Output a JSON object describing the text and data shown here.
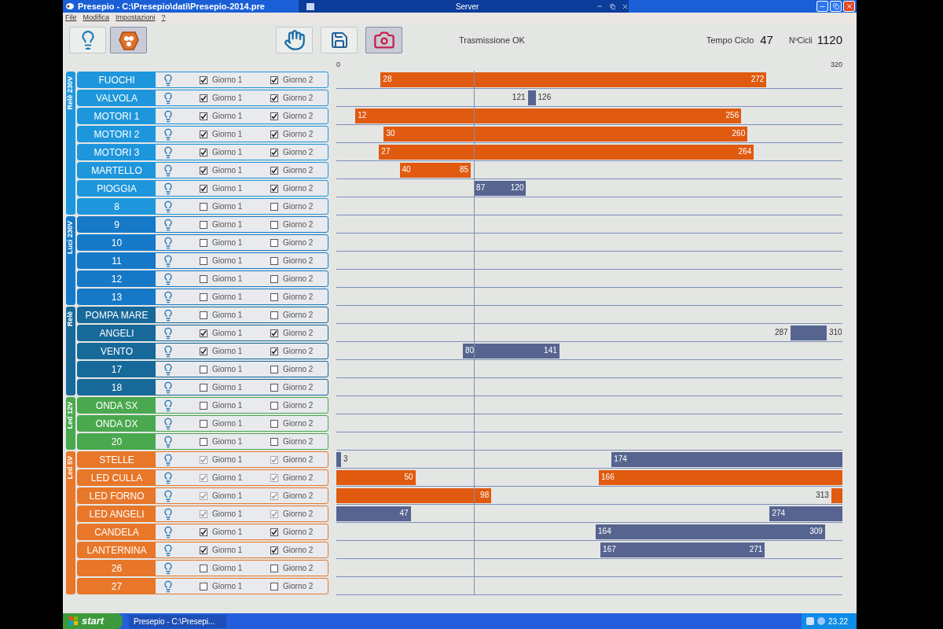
{
  "window": {
    "title": "Presepio - C:\\Presepio\\dati\\Presepio-2014.pre",
    "overlay_title": "Server"
  },
  "menu": [
    "File",
    "Modifica",
    "Impostazioni",
    "?"
  ],
  "toolbar": [
    {
      "kind": "bulb",
      "selected": false
    },
    {
      "kind": "blob",
      "selected": true
    },
    {
      "kind": "hand",
      "selected": false
    },
    {
      "kind": "save",
      "selected": false
    },
    {
      "kind": "camera",
      "selected": true
    }
  ],
  "status": {
    "message": "Trasmissione OK",
    "cycle_time_label": "Tempo Ciclo",
    "cycle_time": "47",
    "cycles_label": "NºCicli",
    "cycles": "1120"
  },
  "axis": {
    "min": "0",
    "max": "320"
  },
  "groups": [
    {
      "label": "Relè 230V",
      "color": "#1e96dc",
      "rows": [
        {
          "name": "FUOCHI",
          "days": [
            {
              "label": "Giorno 1",
              "checked": true,
              "disabled": false
            },
            {
              "label": "Giorno 2",
              "checked": true,
              "disabled": false
            }
          ],
          "segments": [
            {
              "from": "28",
              "to": "272",
              "color": "#e05a10"
            }
          ]
        },
        {
          "name": "VALVOLA",
          "days": [
            {
              "label": "Giorno 1",
              "checked": true,
              "disabled": false
            },
            {
              "label": "Giorno 2",
              "checked": true,
              "disabled": false
            }
          ],
          "segments": [
            {
              "from": "121",
              "to": "126",
              "color": "#56648f"
            }
          ]
        },
        {
          "name": "MOTORI 1",
          "days": [
            {
              "label": "Giorno 1",
              "checked": true,
              "disabled": false
            },
            {
              "label": "Giorno 2",
              "checked": true,
              "disabled": false
            }
          ],
          "segments": [
            {
              "from": "12",
              "to": "256",
              "color": "#e05a10"
            }
          ]
        },
        {
          "name": "MOTORI 2",
          "days": [
            {
              "label": "Giorno 1",
              "checked": true,
              "disabled": false
            },
            {
              "label": "Giorno 2",
              "checked": true,
              "disabled": false
            }
          ],
          "segments": [
            {
              "from": "30",
              "to": "260",
              "color": "#e05a10"
            }
          ]
        },
        {
          "name": "MOTORI 3",
          "days": [
            {
              "label": "Giorno 1",
              "checked": true,
              "disabled": false
            },
            {
              "label": "Giorno 2",
              "checked": true,
              "disabled": false
            }
          ],
          "segments": [
            {
              "from": "27",
              "to": "264",
              "color": "#e05a10"
            }
          ]
        },
        {
          "name": "MARTELLO",
          "days": [
            {
              "label": "Giorno 1",
              "checked": true,
              "disabled": false
            },
            {
              "label": "Giorno 2",
              "checked": true,
              "disabled": false
            }
          ],
          "segments": [
            {
              "from": "40",
              "to": "85",
              "color": "#e05a10"
            }
          ]
        },
        {
          "name": "PIOGGIA",
          "days": [
            {
              "label": "Giorno 1",
              "checked": true,
              "disabled": false
            },
            {
              "label": "Giorno 2",
              "checked": true,
              "disabled": false
            }
          ],
          "segments": [
            {
              "from": "87",
              "to": "120",
              "color": "#56648f"
            }
          ]
        },
        {
          "name": "8",
          "days": [
            {
              "label": "Giorno 1",
              "checked": false,
              "disabled": false
            },
            {
              "label": "Giorno 2",
              "checked": false,
              "disabled": false
            }
          ],
          "segments": []
        }
      ]
    },
    {
      "label": "Luci 230V",
      "color": "#1679c8",
      "rows": [
        {
          "name": "9",
          "days": [
            {
              "label": "Giorno 1",
              "checked": false,
              "disabled": false
            },
            {
              "label": "Giorno 2",
              "checked": false,
              "disabled": false
            }
          ],
          "segments": []
        },
        {
          "name": "10",
          "days": [
            {
              "label": "Giorno 1",
              "checked": false,
              "disabled": false
            },
            {
              "label": "Giorno 2",
              "checked": false,
              "disabled": false
            }
          ],
          "segments": []
        },
        {
          "name": "11",
          "days": [
            {
              "label": "Giorno 1",
              "checked": false,
              "disabled": false
            },
            {
              "label": "Giorno 2",
              "checked": false,
              "disabled": false
            }
          ],
          "segments": []
        },
        {
          "name": "12",
          "days": [
            {
              "label": "Giorno 1",
              "checked": false,
              "disabled": false
            },
            {
              "label": "Giorno 2",
              "checked": false,
              "disabled": false
            }
          ],
          "segments": []
        },
        {
          "name": "13",
          "days": [
            {
              "label": "Giorno 1",
              "checked": false,
              "disabled": false
            },
            {
              "label": "Giorno 2",
              "checked": false,
              "disabled": false
            }
          ],
          "segments": []
        }
      ]
    },
    {
      "label": "Relè",
      "color": "#17699a",
      "rows": [
        {
          "name": "POMPA MARE",
          "days": [
            {
              "label": "Giorno 1",
              "checked": false,
              "disabled": false
            },
            {
              "label": "Giorno 2",
              "checked": false,
              "disabled": false
            }
          ],
          "segments": []
        },
        {
          "name": "ANGELI",
          "days": [
            {
              "label": "Giorno 1",
              "checked": true,
              "disabled": false
            },
            {
              "label": "Giorno 2",
              "checked": true,
              "disabled": false
            }
          ],
          "segments": [
            {
              "from": "287",
              "to": "310",
              "color": "#56648f"
            }
          ]
        },
        {
          "name": "VENTO",
          "days": [
            {
              "label": "Giorno 1",
              "checked": true,
              "disabled": false
            },
            {
              "label": "Giorno 2",
              "checked": true,
              "disabled": false
            }
          ],
          "segments": [
            {
              "from": "80",
              "to": "141",
              "color": "#56648f"
            }
          ]
        },
        {
          "name": "17",
          "days": [
            {
              "label": "Giorno 1",
              "checked": false,
              "disabled": false
            },
            {
              "label": "Giorno 2",
              "checked": false,
              "disabled": false
            }
          ],
          "segments": []
        },
        {
          "name": "18",
          "days": [
            {
              "label": "Giorno 1",
              "checked": false,
              "disabled": false
            },
            {
              "label": "Giorno 2",
              "checked": false,
              "disabled": false
            }
          ],
          "segments": []
        }
      ]
    },
    {
      "label": "Led 12V",
      "color": "#4aa84e",
      "rows": [
        {
          "name": "ONDA SX",
          "days": [
            {
              "label": "Giorno 1",
              "checked": false,
              "disabled": false
            },
            {
              "label": "Giorno 2",
              "checked": false,
              "disabled": false
            }
          ],
          "segments": []
        },
        {
          "name": "ONDA DX",
          "days": [
            {
              "label": "Giorno 1",
              "checked": false,
              "disabled": false
            },
            {
              "label": "Giorno 2",
              "checked": false,
              "disabled": false
            }
          ],
          "segments": []
        },
        {
          "name": "20",
          "days": [
            {
              "label": "Giorno 1",
              "checked": false,
              "disabled": false
            },
            {
              "label": "Giorno 2",
              "checked": false,
              "disabled": false
            }
          ],
          "segments": []
        }
      ]
    },
    {
      "label": "Led 5V",
      "color": "#e8772a",
      "rows": [
        {
          "name": "STELLE",
          "days": [
            {
              "label": "Giorno 1",
              "checked": true,
              "disabled": true
            },
            {
              "label": "Giorno 2",
              "checked": true,
              "disabled": true
            }
          ],
          "segments": [
            {
              "from": "174",
              "to": "3",
              "color": "#56648f"
            }
          ]
        },
        {
          "name": "LED CULLA",
          "days": [
            {
              "label": "Giorno 1",
              "checked": true,
              "disabled": true
            },
            {
              "label": "Giorno 2",
              "checked": true,
              "disabled": true
            }
          ],
          "segments": [
            {
              "from": "166",
              "to": "50",
              "color": "#e05a10"
            }
          ]
        },
        {
          "name": "LED FORNO",
          "days": [
            {
              "label": "Giorno 1",
              "checked": true,
              "disabled": true
            },
            {
              "label": "Giorno 2",
              "checked": true,
              "disabled": true
            }
          ],
          "segments": [
            {
              "from": "313",
              "to": "98",
              "color": "#e05a10"
            }
          ]
        },
        {
          "name": "LED ANGELI",
          "days": [
            {
              "label": "Giorno 1",
              "checked": true,
              "disabled": true
            },
            {
              "label": "Giorno 2",
              "checked": true,
              "disabled": true
            }
          ],
          "segments": [
            {
              "from": "274",
              "to": "47",
              "color": "#56648f"
            }
          ]
        },
        {
          "name": "CANDELA",
          "days": [
            {
              "label": "Giorno 1",
              "checked": true,
              "disabled": false
            },
            {
              "label": "Giorno 2",
              "checked": true,
              "disabled": false
            }
          ],
          "segments": [
            {
              "from": "164",
              "to": "309",
              "color": "#56648f"
            }
          ]
        },
        {
          "name": "LANTERNINA",
          "days": [
            {
              "label": "Giorno 1",
              "checked": true,
              "disabled": false
            },
            {
              "label": "Giorno 2",
              "checked": true,
              "disabled": false
            }
          ],
          "segments": [
            {
              "from": "167",
              "to": "271",
              "color": "#56648f"
            }
          ]
        },
        {
          "name": "26",
          "days": [
            {
              "label": "Giorno 1",
              "checked": false,
              "disabled": false
            },
            {
              "label": "Giorno 2",
              "checked": false,
              "disabled": false
            }
          ],
          "segments": []
        },
        {
          "name": "27",
          "days": [
            {
              "label": "Giorno 1",
              "checked": false,
              "disabled": false
            },
            {
              "label": "Giorno 2",
              "checked": false,
              "disabled": false
            }
          ],
          "segments": []
        }
      ]
    }
  ],
  "taskbar": {
    "start": "start",
    "task": "Presepio - C:\\Presepi...",
    "clock": "23.22"
  }
}
